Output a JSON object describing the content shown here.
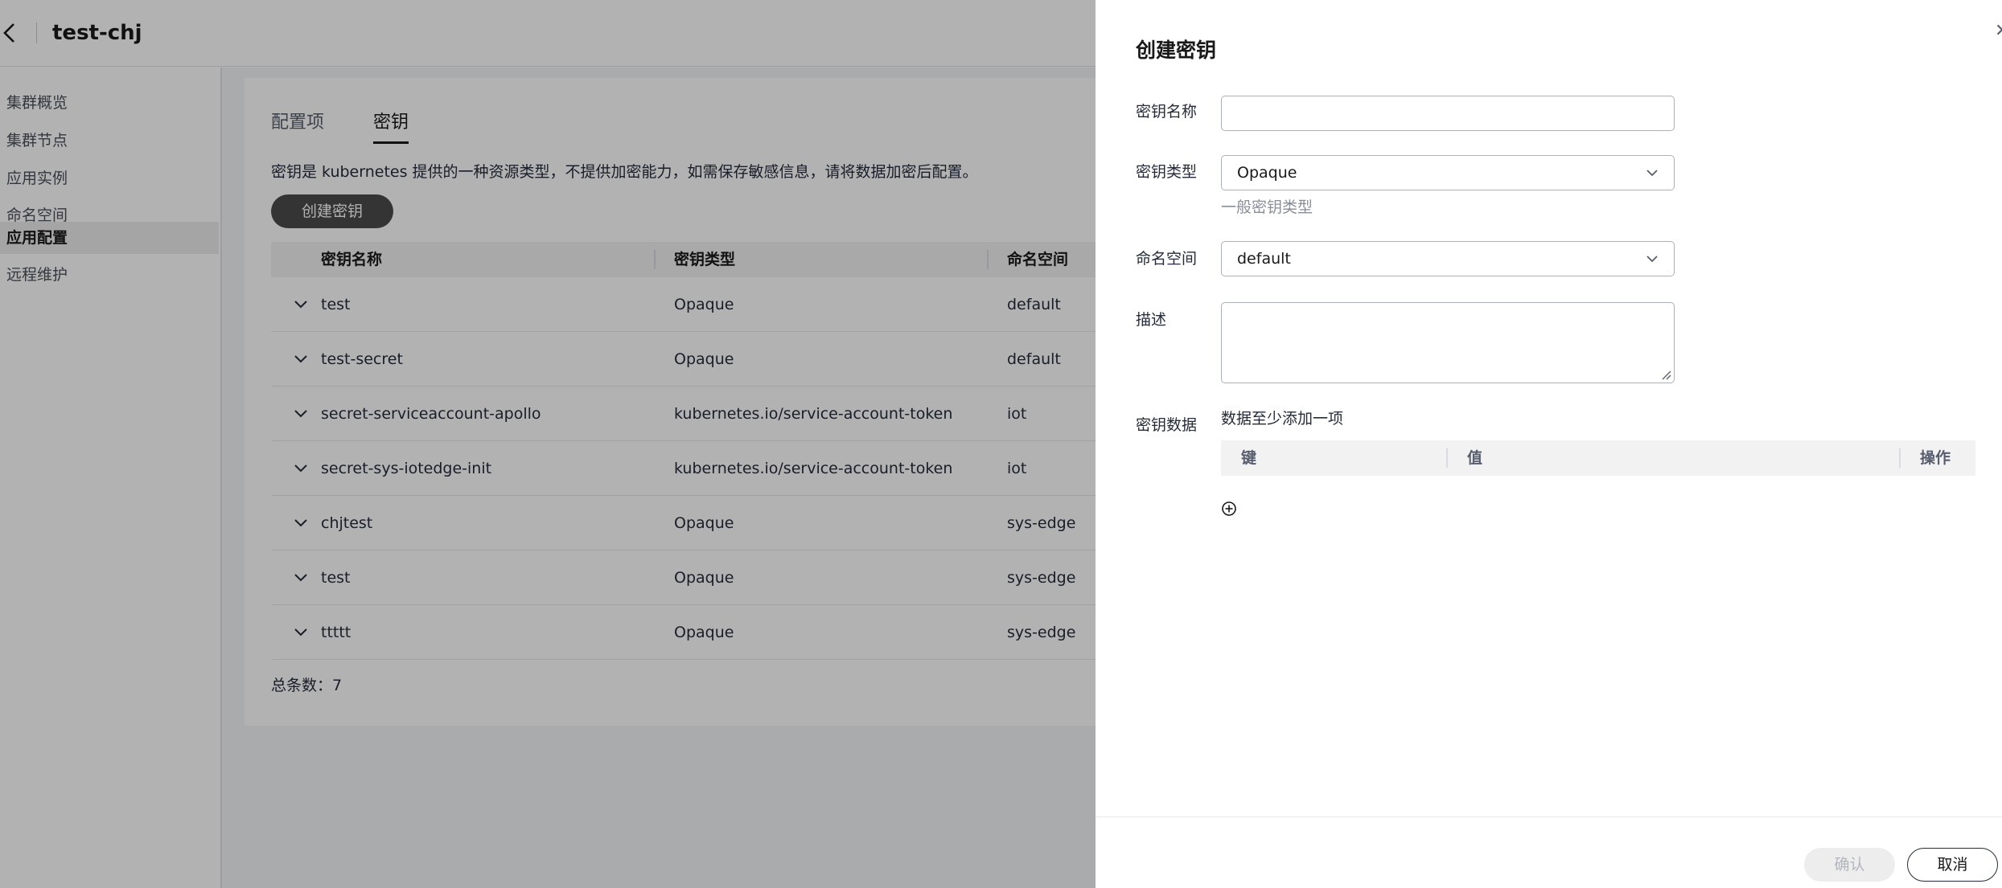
{
  "app": {
    "title": "test-chj"
  },
  "sidebar": {
    "items": [
      {
        "label": "集群概览"
      },
      {
        "label": "集群节点"
      },
      {
        "label": "应用实例"
      },
      {
        "label": "命名空间"
      },
      {
        "label": "应用配置",
        "active": true
      },
      {
        "label": "远程维护"
      }
    ]
  },
  "tabs": [
    {
      "label": "配置项"
    },
    {
      "label": "密钥",
      "active": true
    }
  ],
  "description": "密钥是 kubernetes 提供的一种资源类型，不提供加密能力，如需保存敏感信息，请将数据加密后配置。",
  "create_button": "创建密钥",
  "table": {
    "columns": [
      "密钥名称",
      "密钥类型",
      "命名空间"
    ],
    "rows": [
      {
        "name": "test",
        "type": "Opaque",
        "namespace": "default"
      },
      {
        "name": "test-secret",
        "type": "Opaque",
        "namespace": "default"
      },
      {
        "name": "secret-serviceaccount-apollo",
        "type": "kubernetes.io/service-account-token",
        "namespace": "iot"
      },
      {
        "name": "secret-sys-iotedge-init",
        "type": "kubernetes.io/service-account-token",
        "namespace": "iot"
      },
      {
        "name": "chjtest",
        "type": "Opaque",
        "namespace": "sys-edge"
      },
      {
        "name": "test",
        "type": "Opaque",
        "namespace": "sys-edge"
      },
      {
        "name": "ttttt",
        "type": "Opaque",
        "namespace": "sys-edge"
      }
    ],
    "total": "总条数：7"
  },
  "drawer": {
    "title": "创建密钥",
    "close_icon": "close-icon",
    "fields": {
      "name": {
        "label": "密钥名称",
        "value": "",
        "placeholder": ""
      },
      "type": {
        "label": "密钥类型",
        "value": "Opaque",
        "hint": "一般密钥类型"
      },
      "namespace": {
        "label": "命名空间",
        "value": "default"
      },
      "description": {
        "label": "描述",
        "value": ""
      },
      "data": {
        "label": "密钥数据",
        "note": "数据至少添加一项",
        "columns": [
          "键",
          "值",
          "操作"
        ],
        "add_icon": "plus-circle-icon"
      }
    },
    "confirm": "确认",
    "cancel": "取消"
  },
  "colors": {
    "primary_button": "#4b4b4b",
    "mask": "rgba(0,0,0,0.3)",
    "active_sidebar": "#ececec"
  }
}
